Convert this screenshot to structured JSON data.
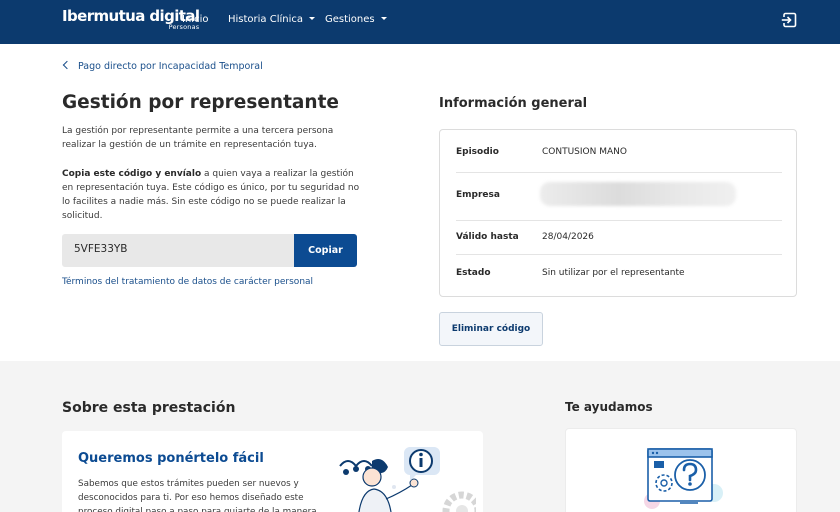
{
  "header": {
    "brand_name": "Ibermutua digital",
    "brand_sub": "Personas",
    "nav": [
      {
        "label": "Inicio"
      },
      {
        "label": "Historia Clínica"
      },
      {
        "label": "Gestiones"
      }
    ]
  },
  "main": {
    "back_link": "Pago directo por Incapacidad Temporal",
    "title": "Gestión por representante",
    "description": "La gestión por representante permite a una tercera persona realizar la gestión de un trámite en representación tuya.",
    "instruction_bold": "Copia este código y envíalo",
    "instruction_rest": " a quien vaya a realizar la gestión en representación tuya. Este código es único, por tu seguridad no lo facilites a nadie más. Sin este código no se puede realizar la solicitud.",
    "code": "5VFE33YB",
    "copy_label": "Copiar",
    "terms_link": "Términos del tratamiento de datos de carácter personal"
  },
  "info": {
    "title": "Información general",
    "rows": [
      {
        "label": "Episodio",
        "value": "CONTUSION MANO"
      },
      {
        "label": "Empresa",
        "value": ""
      },
      {
        "label": "Válido hasta",
        "value": "28/04/2026"
      },
      {
        "label": "Estado",
        "value": "Sin utilizar por el representante"
      }
    ],
    "delete_label": "Eliminar código"
  },
  "about": {
    "title": "Sobre esta prestación",
    "heading": "Queremos ponértelo fácil",
    "text": "Sabemos que estos trámites pueden ser nuevos y desconocidos para ti. Por eso hemos diseñado este proceso digital paso a paso para guiarte de la manera"
  },
  "help": {
    "title": "Te ayudamos"
  },
  "colors": {
    "header_bg": "#0c3a6e",
    "primary_button": "#0c4b92",
    "link": "#1a4f8b"
  }
}
